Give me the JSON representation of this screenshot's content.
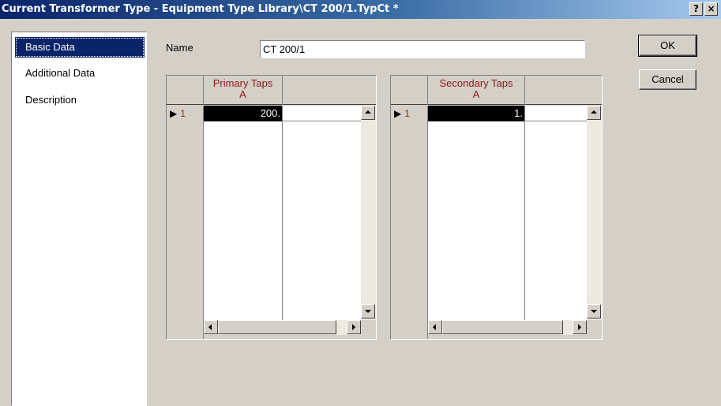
{
  "window": {
    "title": "Current Transformer Type - Equipment Type Library\\CT 200/1.TypCt *",
    "help_label": "?",
    "close_label": "×"
  },
  "sidebar": {
    "items": [
      {
        "label": "Basic Data",
        "selected": true
      },
      {
        "label": "Additional Data",
        "selected": false
      },
      {
        "label": "Description",
        "selected": false
      }
    ]
  },
  "form": {
    "name_label": "Name",
    "name_value": "CT 200/1"
  },
  "buttons": {
    "ok_label": "OK",
    "cancel_label": "Cancel"
  },
  "primary_grid": {
    "column_header": "Primary Taps",
    "column_unit": "A",
    "row_indicator": "▶",
    "rows": [
      {
        "number": "1",
        "value": "200."
      }
    ]
  },
  "secondary_grid": {
    "column_header": "Secondary Taps",
    "column_unit": "A",
    "row_indicator": "▶",
    "rows": [
      {
        "number": "1",
        "value": "1."
      }
    ]
  },
  "colors": {
    "title_gradient_start": "#0a246a",
    "selection": "#0a246a",
    "header_text": "#8b1a1a",
    "face": "#d4d0c8"
  }
}
